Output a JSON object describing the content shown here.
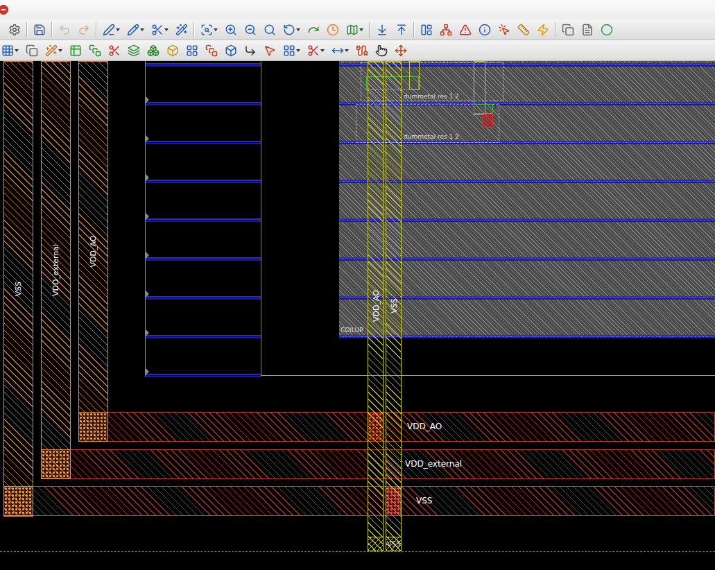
{
  "layout": {
    "vertical_rails": [
      {
        "net": "VSS"
      },
      {
        "net": "VDD_external"
      },
      {
        "net": "VDD_AO"
      }
    ],
    "horizontal_rails": [
      {
        "net": "VDD_AO"
      },
      {
        "net": "VDD_external"
      },
      {
        "net": "VSS"
      }
    ],
    "block_label": "COILUP",
    "block_rails": [
      {
        "net": "VDD_AO"
      },
      {
        "net": "VSS"
      }
    ],
    "instance_labels": [
      "dummetal res 1 2",
      "dummetal res 1 2"
    ],
    "bottom_label": "VSS"
  }
}
